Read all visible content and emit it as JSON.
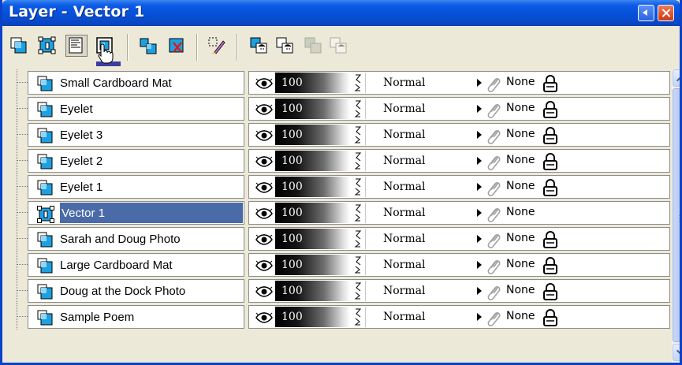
{
  "window": {
    "title": "Layer - Vector 1",
    "title_bar_color": "#0a4fd6"
  },
  "toolbar": {
    "buttons": [
      {
        "name": "new-raster-layer-button",
        "icon": "new-raster-layer-icon"
      },
      {
        "name": "new-vector-layer-button",
        "icon": "new-vector-layer-icon"
      },
      {
        "name": "new-art-media-layer-button",
        "icon": "new-art-media-layer-icon"
      },
      {
        "name": "new-mask-layer-button",
        "icon": "new-mask-layer-icon"
      },
      {
        "name": "duplicate-layer-button",
        "icon": "duplicate-layer-icon"
      },
      {
        "name": "delete-layer-button",
        "icon": "delete-layer-icon"
      },
      {
        "name": "edit-selection-button",
        "icon": "edit-selection-icon"
      },
      {
        "name": "show-all-layers-button",
        "icon": "show-layers-icon"
      },
      {
        "name": "hide-all-layers-button",
        "icon": "hide-layers-icon"
      },
      {
        "name": "lock-layers-button",
        "icon": "lock-layers-icon"
      },
      {
        "name": "unlock-layers-button",
        "icon": "unlock-layers-icon"
      }
    ]
  },
  "layers": [
    {
      "name": "Small Cardboard Mat",
      "opacity": "100",
      "blend": "Normal",
      "mask": "None",
      "locked": true,
      "selected": false,
      "type": "raster"
    },
    {
      "name": "Eyelet",
      "opacity": "100",
      "blend": "Normal",
      "mask": "None",
      "locked": true,
      "selected": false,
      "type": "raster"
    },
    {
      "name": "Eyelet 3",
      "opacity": "100",
      "blend": "Normal",
      "mask": "None",
      "locked": true,
      "selected": false,
      "type": "raster"
    },
    {
      "name": "Eyelet 2",
      "opacity": "100",
      "blend": "Normal",
      "mask": "None",
      "locked": true,
      "selected": false,
      "type": "raster"
    },
    {
      "name": "Eyelet 1",
      "opacity": "100",
      "blend": "Normal",
      "mask": "None",
      "locked": true,
      "selected": false,
      "type": "raster"
    },
    {
      "name": "Vector 1",
      "opacity": "100",
      "blend": "Normal",
      "mask": "None",
      "locked": false,
      "selected": true,
      "type": "vector"
    },
    {
      "name": "Sarah and Doug Photo",
      "opacity": "100",
      "blend": "Normal",
      "mask": "None",
      "locked": true,
      "selected": false,
      "type": "raster"
    },
    {
      "name": "Large Cardboard Mat",
      "opacity": "100",
      "blend": "Normal",
      "mask": "None",
      "locked": true,
      "selected": false,
      "type": "raster"
    },
    {
      "name": "Doug at the Dock Photo",
      "opacity": "100",
      "blend": "Normal",
      "mask": "None",
      "locked": true,
      "selected": false,
      "type": "raster"
    },
    {
      "name": "Sample Poem",
      "opacity": "100",
      "blend": "Normal",
      "mask": "None",
      "locked": true,
      "selected": false,
      "type": "raster"
    }
  ],
  "colors": {
    "selected_row": "#4b6ba8",
    "layer_icon_blue": "#1ea0e0",
    "scrollbar": "#c1d2f6"
  }
}
